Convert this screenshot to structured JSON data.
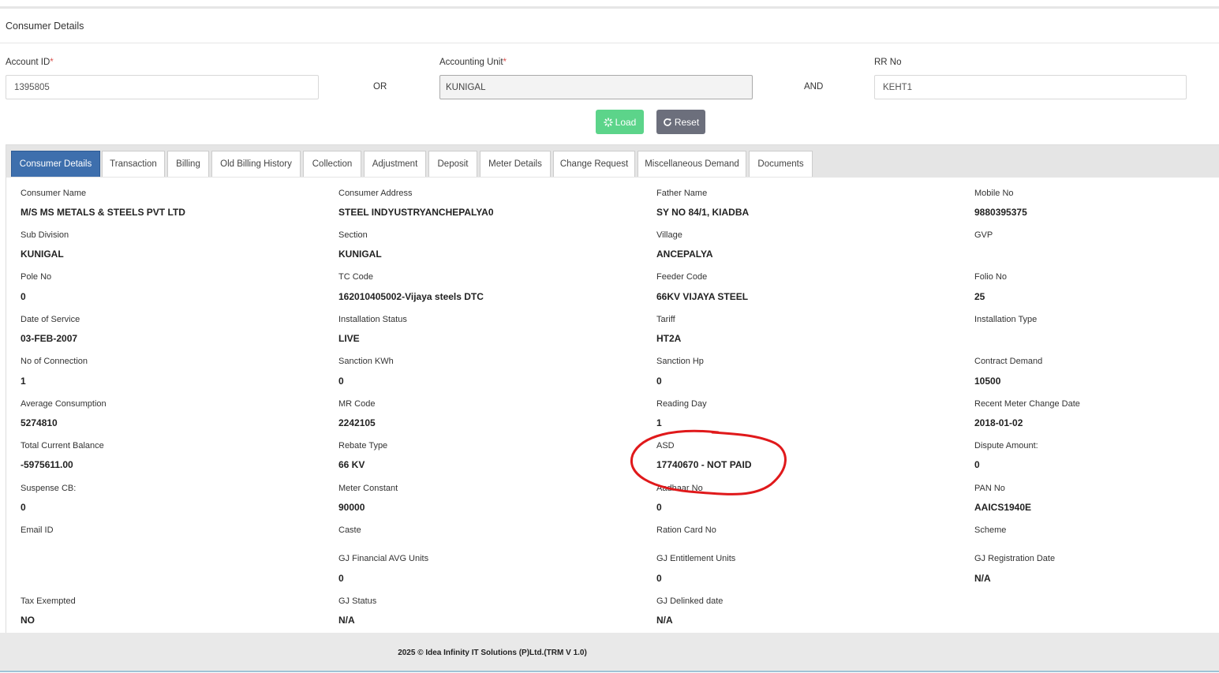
{
  "panel": {
    "title": "Consumer Details"
  },
  "form": {
    "account_id": {
      "label": "Account ID",
      "required_mark": "*",
      "value": "1395805"
    },
    "or_label": "OR",
    "accounting_unit": {
      "label": "Accounting Unit",
      "required_mark": "*",
      "value": "KUNIGAL"
    },
    "and_label": "AND",
    "rr_no": {
      "label": "RR No",
      "value": "KEHT1"
    },
    "load_label": "Load",
    "reset_label": "Reset"
  },
  "tabs": [
    "Consumer Details",
    "Transaction",
    "Billing",
    "Old Billing History",
    "Collection",
    "Adjustment",
    "Deposit",
    "Meter Details",
    "Change Request",
    "Miscellaneous Demand",
    "Documents"
  ],
  "active_tab": "Consumer Details",
  "details": [
    {
      "label": "Consumer Name",
      "value": "M/S MS METALS & STEELS PVT LTD"
    },
    {
      "label": "Consumer Address",
      "value": "STEEL INDYUSTRYANCHEPALYA0"
    },
    {
      "label": "Father Name",
      "value": "SY NO 84/1, KIADBA"
    },
    {
      "label": "Mobile No",
      "value": "9880395375"
    },
    {
      "label": "Sub Division",
      "value": "KUNIGAL"
    },
    {
      "label": "Section",
      "value": "KUNIGAL"
    },
    {
      "label": "Village",
      "value": "ANCEPALYA"
    },
    {
      "label": "GVP",
      "value": ""
    },
    {
      "label": "Pole No",
      "value": "0"
    },
    {
      "label": "TC Code",
      "value": "162010405002-Vijaya steels DTC"
    },
    {
      "label": "Feeder Code",
      "value": "66KV VIJAYA STEEL"
    },
    {
      "label": "Folio No",
      "value": "25"
    },
    {
      "label": "Date of Service",
      "value": "03-FEB-2007"
    },
    {
      "label": "Installation Status",
      "value": "LIVE"
    },
    {
      "label": "Tariff",
      "value": "HT2A"
    },
    {
      "label": "Installation Type",
      "value": ""
    },
    {
      "label": "No of Connection",
      "value": "1"
    },
    {
      "label": "Sanction KWh",
      "value": "0"
    },
    {
      "label": "Sanction Hp",
      "value": "0"
    },
    {
      "label": "Contract Demand",
      "value": "10500"
    },
    {
      "label": "Average Consumption",
      "value": "5274810"
    },
    {
      "label": "MR Code",
      "value": "2242105"
    },
    {
      "label": "Reading Day",
      "value": "1"
    },
    {
      "label": "Recent Meter Change Date",
      "value": "2018-01-02"
    },
    {
      "label": "Total Current Balance",
      "value": "-5975611.00"
    },
    {
      "label": "Rebate Type",
      "value": "66 KV"
    },
    {
      "label": "ASD",
      "value": "17740670 - NOT PAID"
    },
    {
      "label": "Dispute Amount:",
      "value": "0"
    },
    {
      "label": "Suspense CB:",
      "value": "0"
    },
    {
      "label": "Meter Constant",
      "value": "90000"
    },
    {
      "label": "Aadhaar No",
      "value": "0"
    },
    {
      "label": "PAN No",
      "value": "AAICS1940E"
    },
    {
      "label": "Email ID",
      "value": ""
    },
    {
      "label": "Caste",
      "value": ""
    },
    {
      "label": "Ration Card No",
      "value": ""
    },
    {
      "label": "Scheme",
      "value": ""
    },
    {
      "label": "",
      "value": ""
    },
    {
      "label": "GJ Financial AVG Units",
      "value": "0"
    },
    {
      "label": "GJ Entitlement Units",
      "value": "0"
    },
    {
      "label": "GJ Registration Date",
      "value": "N/A"
    },
    {
      "label": "Tax Exempted",
      "value": "NO"
    },
    {
      "label": "GJ Status",
      "value": "N/A"
    },
    {
      "label": "GJ Delinked date",
      "value": "N/A"
    },
    {
      "label": "",
      "value": ""
    }
  ],
  "footer": {
    "text": "2025 © Idea Infinity IT Solutions (P)Ltd.(TRM V 1.0)"
  },
  "colors": {
    "active_tab": "#3e6fad",
    "load_button": "#5cd48a",
    "reset_button": "#6c6f7c",
    "annotation": "#e0191b"
  }
}
